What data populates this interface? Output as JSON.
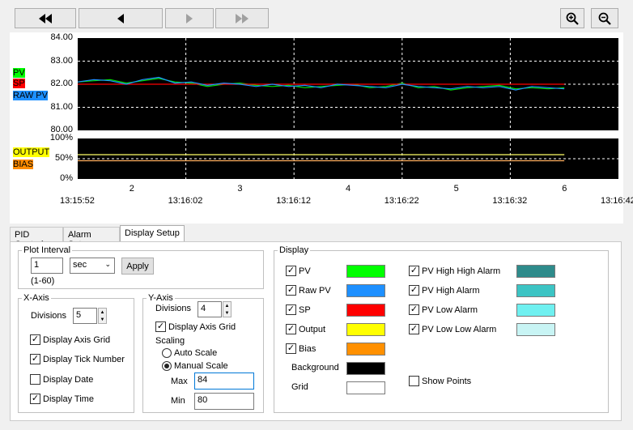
{
  "toolbar": {
    "buttons": [
      {
        "name": "first-button",
        "icon": "double-left-arrow-icon"
      },
      {
        "name": "prev-button",
        "icon": "left-arrow-icon"
      },
      {
        "name": "next-button",
        "icon": "right-arrow-icon"
      },
      {
        "name": "last-button",
        "icon": "double-right-arrow-icon"
      }
    ],
    "zoom_in_icon": "zoom-in-icon",
    "zoom_out_icon": "zoom-out-icon"
  },
  "chart_data": [
    {
      "type": "line",
      "ylim": [
        80,
        84
      ],
      "yticks": [
        "84.00",
        "83.00",
        "82.00",
        "81.00",
        "80.00"
      ],
      "legend": [
        "PV",
        "SP",
        "RAW PV"
      ],
      "legend_colors": [
        "#00ff00",
        "#ff0000",
        "#1e90ff"
      ],
      "x": [
        0,
        2,
        4,
        6,
        8,
        10,
        12,
        14,
        16,
        18,
        20,
        22,
        24,
        26,
        28,
        30,
        32,
        34,
        36,
        38,
        40,
        42,
        44,
        46,
        48,
        50,
        52,
        54,
        56,
        58,
        60
      ],
      "series": [
        {
          "name": "PV",
          "color": "#00e000",
          "values": [
            82.1,
            82.15,
            82.2,
            82.05,
            82.15,
            82.25,
            82.1,
            82.05,
            81.9,
            82.0,
            82.05,
            81.95,
            81.9,
            81.95,
            81.85,
            81.9,
            81.95,
            82.0,
            81.85,
            81.9,
            82.05,
            81.85,
            81.9,
            81.75,
            81.85,
            81.9,
            81.95,
            81.8,
            81.85,
            81.8,
            81.85
          ]
        },
        {
          "name": "SP",
          "color": "#ff0000",
          "values": [
            82.0,
            82.0,
            82.0,
            82.0,
            82.0,
            82.0,
            82.0,
            82.0,
            82.0,
            82.0,
            82.0,
            82.0,
            82.0,
            82.0,
            82.0,
            82.0,
            82.0,
            82.0,
            82.0,
            82.0,
            82.0,
            82.0,
            82.0,
            82.0,
            82.0,
            82.0,
            82.0,
            82.0,
            82.0,
            82.0,
            82.0
          ]
        },
        {
          "name": "RAW PV",
          "color": "#1e90ff",
          "values": [
            82.1,
            82.2,
            82.15,
            82.0,
            82.2,
            82.3,
            82.05,
            82.1,
            81.95,
            82.05,
            82.0,
            81.9,
            82.0,
            81.9,
            81.95,
            81.85,
            82.0,
            81.95,
            81.9,
            81.85,
            82.0,
            81.9,
            81.85,
            81.8,
            81.9,
            81.85,
            81.9,
            81.75,
            81.9,
            81.85,
            81.8
          ]
        }
      ]
    },
    {
      "type": "line",
      "ylim": [
        0,
        100
      ],
      "yticks": [
        "100%",
        "50%",
        "0%"
      ],
      "legend": [
        "OUTPUT",
        "BIAS"
      ],
      "legend_colors": [
        "#ffff00",
        "#ff8c00"
      ],
      "x": [
        0,
        60
      ],
      "series": [
        {
          "name": "OUTPUT",
          "color": "#ffff66",
          "values": [
            60,
            60
          ]
        },
        {
          "name": "BIAS",
          "color": "#ffb060",
          "values": [
            45,
            45
          ]
        }
      ]
    }
  ],
  "x_axis": {
    "time_labels": [
      "13:15:52",
      "13:16:02",
      "13:16:12",
      "13:16:22",
      "13:16:32",
      "13:16:42"
    ],
    "tick_numbers": [
      "2",
      "3",
      "4",
      "5",
      "6"
    ]
  },
  "tabs": [
    "PID Control",
    "Alarm Setup",
    "Display Setup"
  ],
  "plot_interval": {
    "legend": "Plot Interval",
    "value": "1",
    "unit": "sec",
    "range": "(1-60)",
    "apply": "Apply"
  },
  "x_axis_group": {
    "legend": "X-Axis",
    "divisions_label": "Divisions",
    "divisions": "5",
    "grid": "Display Axis Grid",
    "tick": "Display Tick Number",
    "date": "Display Date",
    "time": "Display Time"
  },
  "y_axis_group": {
    "legend": "Y-Axis",
    "divisions_label": "Divisions",
    "divisions": "4",
    "grid": "Display Axis Grid",
    "scaling": "Scaling",
    "auto": "Auto Scale",
    "manual": "Manual Scale",
    "max_label": "Max",
    "max": "84",
    "min_label": "Min",
    "min": "80"
  },
  "display_group": {
    "legend": "Display",
    "items": [
      {
        "label": "PV",
        "color": "#00ff00",
        "checked": true
      },
      {
        "label": "Raw PV",
        "color": "#1e90ff",
        "checked": true
      },
      {
        "label": "SP",
        "color": "#ff0000",
        "checked": true
      },
      {
        "label": "Output",
        "color": "#ffff00",
        "checked": true
      },
      {
        "label": "Bias",
        "color": "#ff9000",
        "checked": true
      },
      {
        "label": "Background",
        "color": "#000000",
        "checked": false
      },
      {
        "label": "Grid",
        "color": "#ffffff",
        "checked": false
      }
    ],
    "alarms": [
      {
        "label": "PV High High Alarm",
        "color": "#2e8b8b",
        "checked": true
      },
      {
        "label": "PV High Alarm",
        "color": "#3cc4c4",
        "checked": true
      },
      {
        "label": "PV Low Alarm",
        "color": "#6ff0f0",
        "checked": true
      },
      {
        "label": "PV Low Low Alarm",
        "color": "#c8f4f4",
        "checked": true
      }
    ],
    "show_points": "Show Points"
  }
}
